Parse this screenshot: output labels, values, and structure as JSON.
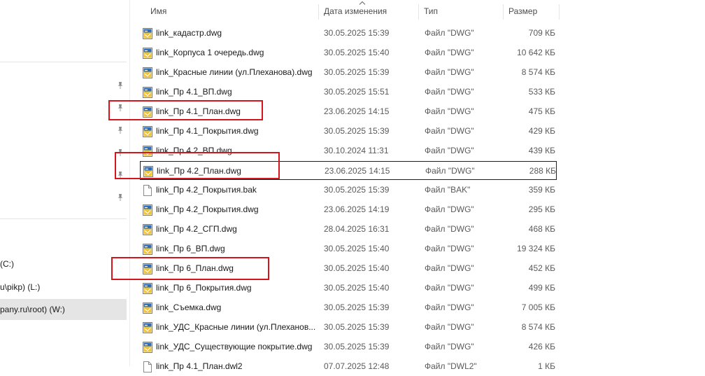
{
  "sidebar": {
    "drives": [
      {
        "label": "(C:)"
      },
      {
        "label": "u\\pikp) (L:)"
      },
      {
        "label": "pany.ru\\root) (W:)"
      }
    ]
  },
  "columns": {
    "name": "Имя",
    "date": "Дата изменения",
    "type": "Тип",
    "size": "Размер"
  },
  "files": [
    {
      "name": "link_кадастр.dwg",
      "date": "30.05.2025 15:39",
      "type": "Файл \"DWG\"",
      "size": "709 КБ",
      "icon": "dwg-file-icon"
    },
    {
      "name": "link_Корпуса 1 очередь.dwg",
      "date": "30.05.2025 15:40",
      "type": "Файл \"DWG\"",
      "size": "10 642 КБ",
      "icon": "dwg-file-icon"
    },
    {
      "name": "link_Красные линии (ул.Плеханова).dwg",
      "date": "30.05.2025 15:39",
      "type": "Файл \"DWG\"",
      "size": "8 574 КБ",
      "icon": "dwg-file-icon"
    },
    {
      "name": "link_Пр 4.1_ВП.dwg",
      "date": "30.05.2025 15:51",
      "type": "Файл \"DWG\"",
      "size": "533 КБ",
      "icon": "dwg-file-icon"
    },
    {
      "name": "link_Пр 4.1_План.dwg",
      "date": "23.06.2025 14:15",
      "type": "Файл \"DWG\"",
      "size": "475 КБ",
      "icon": "dwg-file-icon"
    },
    {
      "name": "link_Пр 4.1_Покрытия.dwg",
      "date": "30.05.2025 15:39",
      "type": "Файл \"DWG\"",
      "size": "429 КБ",
      "icon": "dwg-file-icon"
    },
    {
      "name": "link_Пр 4.2_ВП.dwg",
      "date": "30.10.2024 11:31",
      "type": "Файл \"DWG\"",
      "size": "439 КБ",
      "icon": "dwg-file-icon"
    },
    {
      "name": "link_Пр 4.2_План.dwg",
      "date": "23.06.2025 14:15",
      "type": "Файл \"DWG\"",
      "size": "288 КБ",
      "icon": "dwg-file-icon"
    },
    {
      "name": "link_Пр 4.2_Покрытия.bak",
      "date": "30.05.2025 15:39",
      "type": "Файл \"BAK\"",
      "size": "359 КБ",
      "icon": "blank-file-icon"
    },
    {
      "name": "link_Пр 4.2_Покрытия.dwg",
      "date": "23.06.2025 14:19",
      "type": "Файл \"DWG\"",
      "size": "295 КБ",
      "icon": "dwg-file-icon"
    },
    {
      "name": "link_Пр 4.2_СГП.dwg",
      "date": "28.04.2025 16:31",
      "type": "Файл \"DWG\"",
      "size": "468 КБ",
      "icon": "dwg-file-icon"
    },
    {
      "name": "link_Пр 6_ВП.dwg",
      "date": "30.05.2025 15:40",
      "type": "Файл \"DWG\"",
      "size": "19 324 КБ",
      "icon": "dwg-file-icon"
    },
    {
      "name": "link_Пр 6_План.dwg",
      "date": "30.05.2025 15:40",
      "type": "Файл \"DWG\"",
      "size": "452 КБ",
      "icon": "dwg-file-icon"
    },
    {
      "name": "link_Пр 6_Покрытия.dwg",
      "date": "30.05.2025 15:40",
      "type": "Файл \"DWG\"",
      "size": "499 КБ",
      "icon": "dwg-file-icon"
    },
    {
      "name": "link_Съемка.dwg",
      "date": "30.05.2025 15:39",
      "type": "Файл \"DWG\"",
      "size": "7 005 КБ",
      "icon": "dwg-file-icon"
    },
    {
      "name": "link_УДС_Красные линии (ул.Плеханов...",
      "date": "30.05.2025 15:39",
      "type": "Файл \"DWG\"",
      "size": "8 574 КБ",
      "icon": "dwg-file-icon"
    },
    {
      "name": "link_УДС_Существующие покрытие.dwg",
      "date": "30.05.2025 15:39",
      "type": "Файл \"DWG\"",
      "size": "426 КБ",
      "icon": "dwg-file-icon"
    },
    {
      "name": "link_Пр 4.1_План.dwl2",
      "date": "07.07.2025 12:48",
      "type": "Файл \"DWL2\"",
      "size": "1 КБ",
      "icon": "blank-file-icon"
    }
  ],
  "colors": {
    "highlight": "#d4161c",
    "dwg_icon_yellow": "#f2c230",
    "dwg_icon_blue": "#2b6cb8"
  }
}
